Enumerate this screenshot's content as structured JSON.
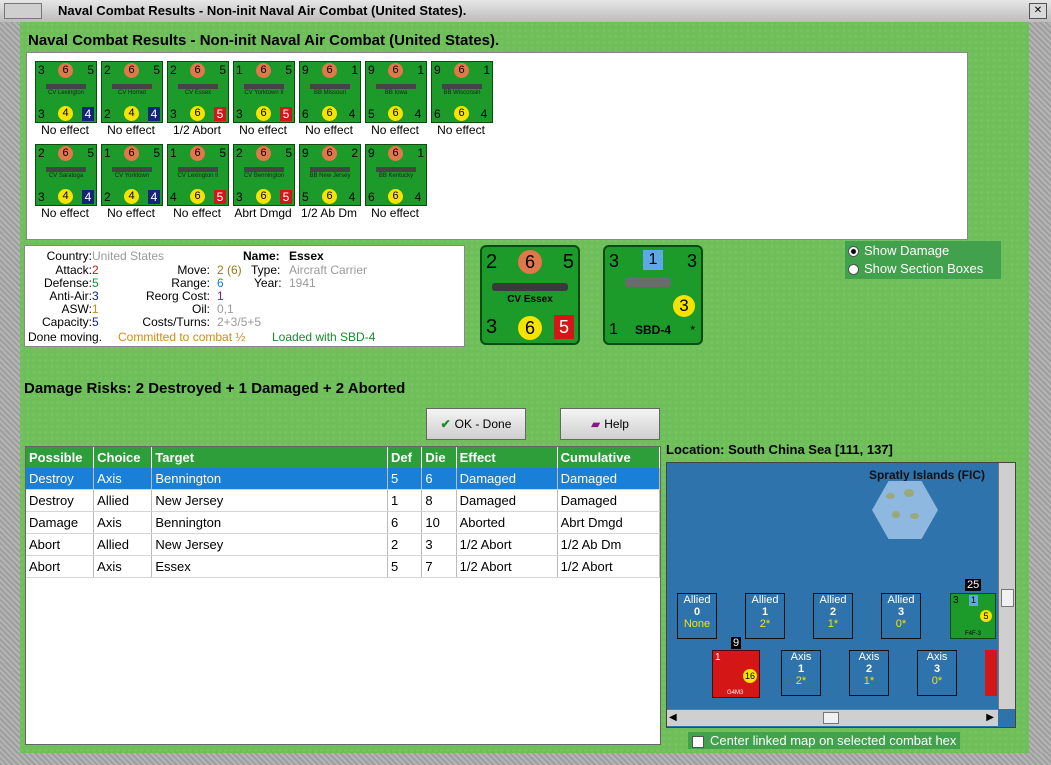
{
  "window": {
    "title": "Naval Combat Results - Non-init Naval Air Combat (United States)."
  },
  "heading": "Naval Combat Results - Non-init Naval Air Combat (United States).",
  "units": [
    {
      "name": "CV Lexington",
      "tl": "3",
      "circ": "6",
      "tr": "5",
      "bl": "3",
      "ycirc": "4",
      "br": "4",
      "br_color": "#16237a",
      "effect": "No effect"
    },
    {
      "name": "CV Hornet",
      "tl": "2",
      "circ": "6",
      "tr": "5",
      "bl": "2",
      "ycirc": "4",
      "br": "4",
      "br_color": "#16237a",
      "effect": "No effect"
    },
    {
      "name": "CV Essex",
      "tl": "2",
      "circ": "6",
      "tr": "5",
      "bl": "3",
      "ycirc": "6",
      "br": "5",
      "br_color": "#d41616",
      "effect": "1/2 Abort"
    },
    {
      "name": "CV Yorktown II",
      "tl": "1",
      "circ": "6",
      "tr": "5",
      "bl": "3",
      "ycirc": "6",
      "br": "5",
      "br_color": "#d41616",
      "effect": "No effect"
    },
    {
      "name": "BB Missouri",
      "tl": "9",
      "circ": "6",
      "tr": "1",
      "bl": "6",
      "ycirc": "6",
      "br": "4",
      "br_color": "",
      "effect": "No effect"
    },
    {
      "name": "BB Iowa",
      "tl": "9",
      "circ": "6",
      "tr": "1",
      "bl": "5",
      "ycirc": "6",
      "br": "4",
      "br_color": "",
      "effect": "No effect"
    },
    {
      "name": "BB Wisconsin",
      "tl": "9",
      "circ": "6",
      "tr": "1",
      "bl": "6",
      "ycirc": "6",
      "br": "4",
      "br_color": "",
      "effect": "No effect"
    },
    {
      "name": "CV Saratoga",
      "tl": "2",
      "circ": "6",
      "tr": "5",
      "bl": "3",
      "ycirc": "4",
      "br": "4",
      "br_color": "#16237a",
      "effect": "No effect"
    },
    {
      "name": "CV Yorktown",
      "tl": "1",
      "circ": "6",
      "tr": "5",
      "bl": "2",
      "ycirc": "4",
      "br": "4",
      "br_color": "#16237a",
      "effect": "No effect"
    },
    {
      "name": "CV Lexington II",
      "tl": "1",
      "circ": "6",
      "tr": "5",
      "bl": "4",
      "ycirc": "6",
      "br": "5",
      "br_color": "#d41616",
      "effect": "No effect"
    },
    {
      "name": "CV Bennington",
      "tl": "2",
      "circ": "6",
      "tr": "5",
      "bl": "3",
      "ycirc": "6",
      "br": "5",
      "br_color": "#d41616",
      "effect": "Abrt Dmgd"
    },
    {
      "name": "BB New Jersey",
      "tl": "9",
      "circ": "6",
      "tr": "2",
      "bl": "5",
      "ycirc": "6",
      "br": "4",
      "br_color": "",
      "effect": "1/2 Ab Dm"
    },
    {
      "name": "BB Kentucky",
      "tl": "9",
      "circ": "6",
      "tr": "1",
      "bl": "6",
      "ycirc": "6",
      "br": "4",
      "br_color": "",
      "effect": "No effect"
    }
  ],
  "info": {
    "country_label": "Country:",
    "country": "United States",
    "attack_label": "Attack:",
    "attack": "2",
    "defense_label": "Defense:",
    "defense": "5",
    "antiair_label": "Anti-Air:",
    "antiair": "3",
    "asw_label": "ASW:",
    "asw": "1",
    "capacity_label": "Capacity:",
    "capacity": "5",
    "name_label": "Name:",
    "name": "Essex",
    "move_label": "Move:",
    "move": "2 (6)",
    "type_label": "Type:",
    "type": "Aircraft Carrier",
    "range_label": "Range:",
    "range": "6",
    "year_label": "Year:",
    "year": "1941",
    "reorg_label": "Reorg Cost:",
    "reorg": "1",
    "oil_label": "Oil:",
    "oil": "0,1",
    "costs_label": "Costs/Turns:",
    "costs": "2+3/5+5",
    "status_done": "Done moving.",
    "status_committed": "Committed to combat ½",
    "status_loaded": "Loaded with SBD-4"
  },
  "big_ship": {
    "tl": "2",
    "circ": "6",
    "tr": "5",
    "name": "CV Essex",
    "bl": "3",
    "ycirc": "6",
    "br": "5"
  },
  "big_plane": {
    "tl": "3",
    "badge": "1",
    "tr": "3",
    "ycirc": "3",
    "bl": "1",
    "name": "SBD-4",
    "star": "*"
  },
  "options": {
    "show_damage": "Show Damage",
    "show_sections": "Show Section Boxes"
  },
  "damage_risks": "Damage Risks:  2 Destroyed + 1 Damaged + 2 Aborted",
  "buttons": {
    "ok": "OK - Done",
    "help": "Help"
  },
  "table": {
    "headers": [
      "Possible",
      "Choice",
      "Target",
      "Def",
      "Die",
      "Effect",
      "Cumulative"
    ],
    "rows": [
      [
        "Destroy",
        "Axis",
        "Bennington",
        "5",
        "6",
        "Damaged",
        "Damaged"
      ],
      [
        "Destroy",
        "Allied",
        "New Jersey",
        "1",
        "8",
        "Damaged",
        "Damaged"
      ],
      [
        "Damage",
        "Axis",
        "Bennington",
        "6",
        "10",
        "Aborted",
        "Abrt Dmgd"
      ],
      [
        "Abort",
        "Allied",
        "New Jersey",
        "2",
        "3",
        "1/2 Abort",
        "1/2 Ab Dm"
      ],
      [
        "Abort",
        "Axis",
        "Essex",
        "5",
        "7",
        "1/2 Abort",
        "1/2 Abort"
      ]
    ]
  },
  "location": {
    "label": "Location:",
    "value": "South China Sea [111, 137]"
  },
  "map": {
    "island_label": "Spratly Islands (FIC)",
    "allied_boxes": [
      {
        "t": "Allied",
        "n": "0",
        "v": "None"
      },
      {
        "t": "Allied",
        "n": "1",
        "v": "2*"
      },
      {
        "t": "Allied",
        "n": "2",
        "v": "1*"
      },
      {
        "t": "Allied",
        "n": "3",
        "v": "0*"
      }
    ],
    "axis_boxes": [
      {
        "t": "Axis",
        "n": "1",
        "v": "2*"
      },
      {
        "t": "Axis",
        "n": "2",
        "v": "1*"
      },
      {
        "t": "Axis",
        "n": "3",
        "v": "0*"
      }
    ],
    "allied_stack": "25",
    "allied_unit_tl": "3",
    "allied_unit_badge": "1",
    "allied_unit_y": "5",
    "allied_unit_name": "F4F-3",
    "axis_stack": "9",
    "axis_unit_tl": "1",
    "axis_unit_y": "16",
    "axis_unit_name": "G4M3"
  },
  "center_linked": "Center linked map on selected combat hex"
}
